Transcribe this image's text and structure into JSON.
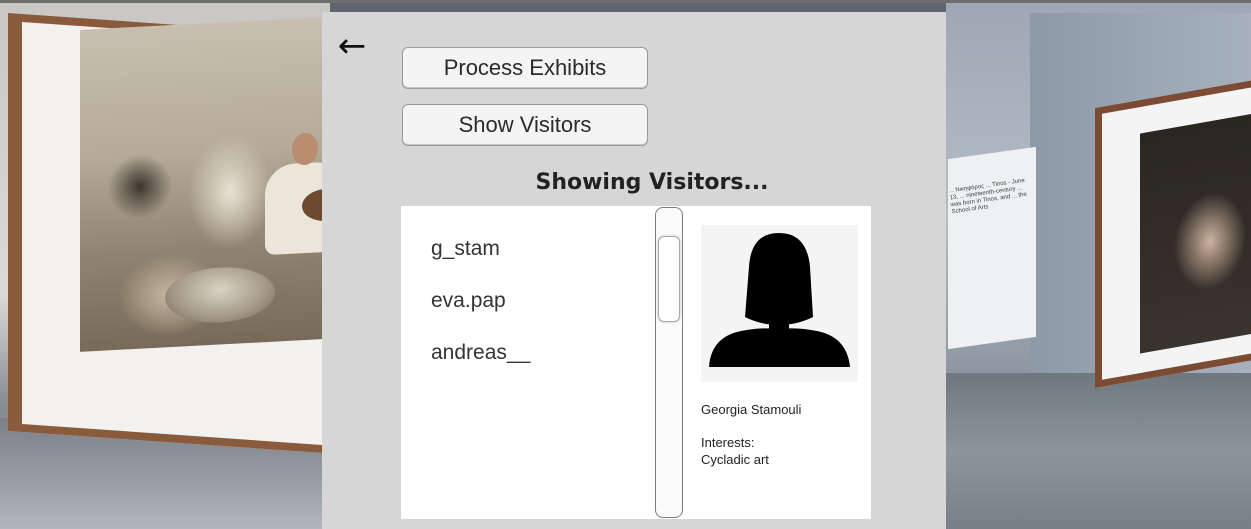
{
  "toolbar": {
    "back_icon": "arrow-left-icon",
    "back_glyph": "←",
    "process_exhibits_label": "Process Exhibits",
    "show_visitors_label": "Show Visitors"
  },
  "status_text": "Showing Visitors...",
  "visitors": [
    {
      "username": "g_stam"
    },
    {
      "username": "eva.pap"
    },
    {
      "username": "andreas__"
    }
  ],
  "selected_visitor": {
    "avatar_icon": "female-silhouette-icon",
    "full_name": "Georgia Stamouli",
    "interests_label": "Interests:",
    "interests": "Cycladic art"
  },
  "background": {
    "wall_label_text": "... Νικηφόρος ... Tinos - June 13, ... nineteenth-century ... was born in Tinos, and ... the School of Arts"
  },
  "colors": {
    "panel_bg": "#d6d6d6",
    "button_bg": "#f4f4f4",
    "list_bg": "#ffffff",
    "frame_wood": "#8a5a3c"
  }
}
